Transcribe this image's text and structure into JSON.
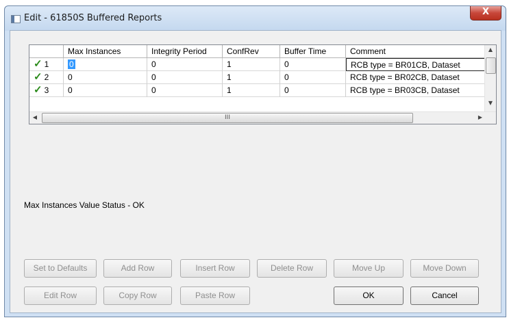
{
  "window": {
    "title": "Edit - 61850S Buffered Reports",
    "close_glyph": "X"
  },
  "grid": {
    "columns": [
      "",
      "Max Instances",
      "Integrity Period",
      "ConfRev",
      "Buffer Time",
      "Comment"
    ],
    "rows": [
      {
        "status_icon": "checkmark-icon",
        "index": "1",
        "max_instances": "0",
        "integrity_period": "0",
        "conf_rev": "1",
        "buffer_time": "0",
        "comment": "RCB type = BR01CB, Dataset"
      },
      {
        "status_icon": "checkmark-icon",
        "index": "2",
        "max_instances": "0",
        "integrity_period": "0",
        "conf_rev": "1",
        "buffer_time": "0",
        "comment": "RCB type = BR02CB, Dataset"
      },
      {
        "status_icon": "checkmark-icon",
        "index": "3",
        "max_instances": "0",
        "integrity_period": "0",
        "conf_rev": "1",
        "buffer_time": "0",
        "comment": "RCB type = BR03CB, Dataset"
      }
    ],
    "hscroll_grip": "III"
  },
  "status_text": "Max Instances Value Status - OK",
  "buttons": {
    "set_defaults": "Set to Defaults",
    "add_row": "Add Row",
    "insert_row": "Insert Row",
    "delete_row": "Delete Row",
    "move_up": "Move Up",
    "move_down": "Move Down",
    "edit_row": "Edit Row",
    "copy_row": "Copy Row",
    "paste_row": "Paste Row",
    "ok": "OK",
    "cancel": "Cancel"
  },
  "colors": {
    "selection": "#3399ff",
    "check": "#2a8a1a",
    "close": "#c7473a"
  }
}
